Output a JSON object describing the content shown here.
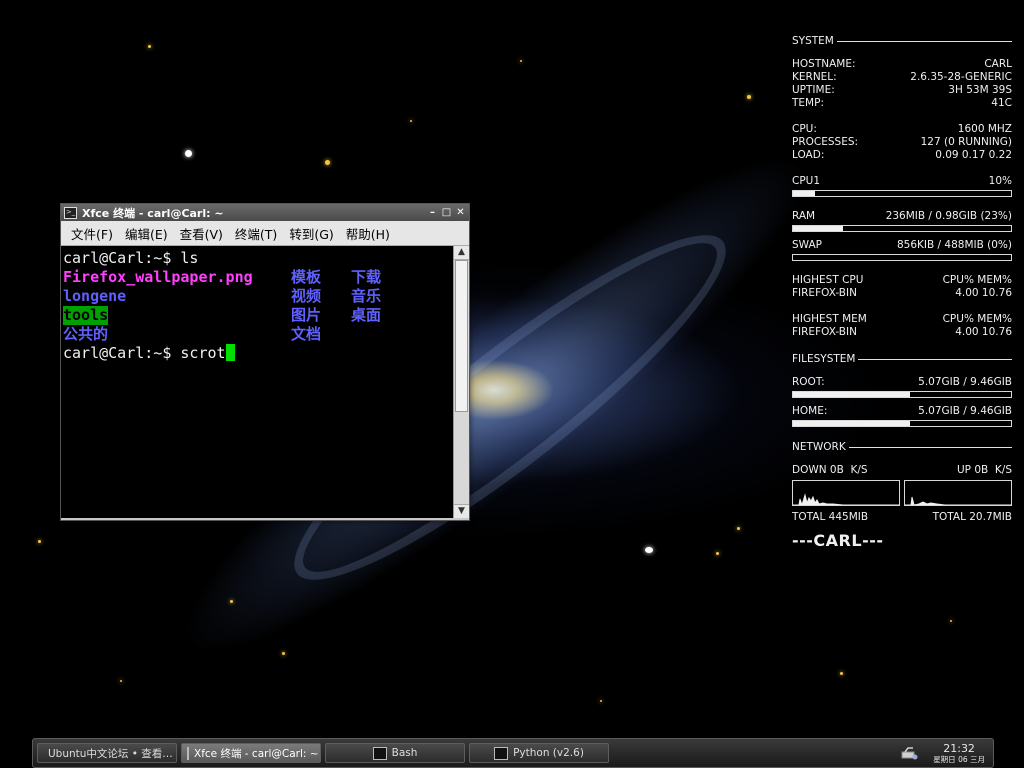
{
  "desktop": {
    "background": "andromeda-galaxy-wallpaper"
  },
  "conky": {
    "system": {
      "heading": "SYSTEM",
      "hostname_label": "HOSTNAME:",
      "hostname": "CARL",
      "kernel_label": "KERNEL:",
      "kernel": "2.6.35-28-GENERIC",
      "uptime_label": "UPTIME:",
      "uptime": "3H 53M 39S",
      "temp_label": "TEMP:",
      "temp": "41C",
      "cpu_label": "CPU:",
      "cpu": "1600 MHZ",
      "processes_label": "PROCESSES:",
      "processes": "127 (0 RUNNING)",
      "load_label": "LOAD:",
      "load": "0.09 0.17 0.22",
      "cpu1_label": "CPU1",
      "cpu1": "10%",
      "cpu1_fraction": 0.1,
      "ram_label": "RAM",
      "ram": "236MIB / 0.98GIB (23%)",
      "ram_fraction": 0.23,
      "swap_label": "SWAP",
      "swap": "856KIB / 488MIB (0%)",
      "swap_fraction": 0.0,
      "highest_cpu_label": "HIGHEST CPU",
      "highest_cpu_cols": "CPU% MEM%",
      "highest_cpu_proc": "FIREFOX-BIN",
      "highest_cpu_vals": "4.00 10.76",
      "highest_mem_label": "HIGHEST MEM",
      "highest_mem_cols": "CPU% MEM%",
      "highest_mem_proc": "FIREFOX-BIN",
      "highest_mem_vals": "4.00 10.76"
    },
    "filesystem": {
      "heading": "FILESYSTEM",
      "root_label": "ROOT:",
      "root": "5.07GIB / 9.46GIB",
      "root_fraction": 0.536,
      "home_label": "HOME:",
      "home": "5.07GIB / 9.46GIB",
      "home_fraction": 0.536
    },
    "network": {
      "heading": "NETWORK",
      "down_label": "DOWN 0B",
      "down_unit": "K/S",
      "up_label": "UP 0B",
      "up_unit": "K/S",
      "total_down": "TOTAL 445MIB",
      "total_up": "TOTAL 20.7MIB"
    },
    "signature": "---CARL---"
  },
  "terminal": {
    "title": "Xfce 终端 - carl@Carl: ~",
    "menu": [
      "文件(F)",
      "编辑(E)",
      "查看(V)",
      "终端(T)",
      "转到(G)",
      "帮助(H)"
    ],
    "prompt1": "carl@Carl:~$ ls",
    "files": {
      "f1": "Firefox_wallpaper.png",
      "f2": "模板",
      "f3": "下载",
      "f4": "longene",
      "f5": "视频",
      "f6": "音乐",
      "f7": "tools",
      "f8": "图片",
      "f9": "桌面",
      "f10": "公共的",
      "f11": "文档"
    },
    "prompt2": "carl@Carl:~$ scrot"
  },
  "taskbar": {
    "tasks": [
      {
        "label": "Ubuntu中文论坛 • 查看…",
        "icon": "firefox-icon"
      },
      {
        "label": "Xfce 终端 - carl@Carl: ~",
        "icon": "terminal-icon"
      },
      {
        "label": "Bash",
        "icon": "terminal-icon"
      },
      {
        "label": "Python (v2.6)",
        "icon": "terminal-icon"
      }
    ],
    "clock_time": "21:32",
    "clock_date": "星期日 06 三月"
  }
}
